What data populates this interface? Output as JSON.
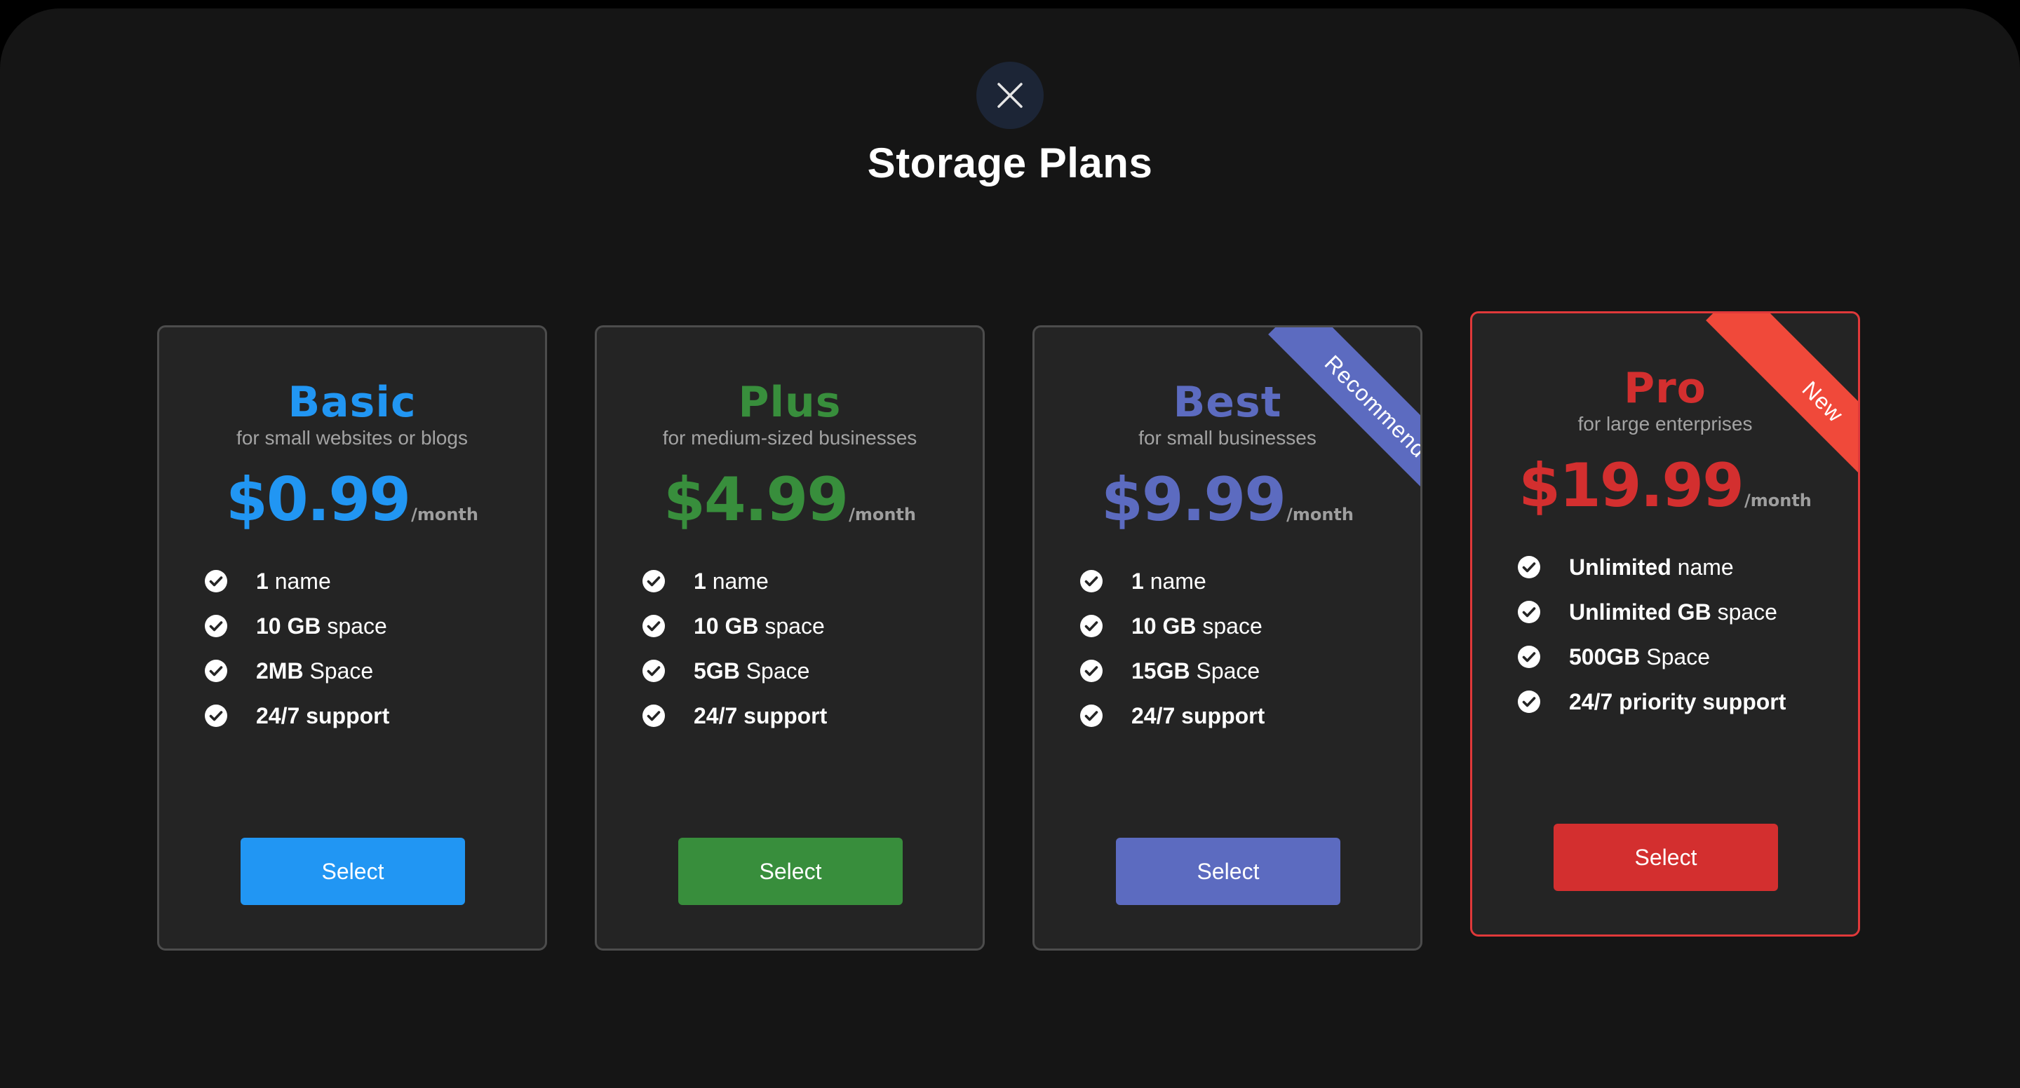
{
  "header": {
    "title": "Storage Plans"
  },
  "plans": [
    {
      "name": "Basic",
      "description": "for small websites or blogs",
      "price": "$0.99",
      "period": "/month",
      "color": "#2196f3",
      "features": [
        {
          "bold": "1",
          "rest": " name"
        },
        {
          "bold": "10 GB",
          "rest": " space"
        },
        {
          "bold": "2MB",
          "rest": " Space"
        },
        {
          "bold": "24/7 support",
          "rest": ""
        }
      ],
      "select_label": "Select"
    },
    {
      "name": "Plus",
      "description": "for medium-sized businesses",
      "price": "$4.99",
      "period": "/month",
      "color": "#388e3c",
      "features": [
        {
          "bold": "1",
          "rest": " name"
        },
        {
          "bold": "10 GB",
          "rest": " space"
        },
        {
          "bold": "5GB",
          "rest": " Space"
        },
        {
          "bold": "24/7 support",
          "rest": ""
        }
      ],
      "select_label": "Select"
    },
    {
      "name": "Best",
      "description": "for small businesses",
      "price": "$9.99",
      "period": "/month",
      "color": "#5c6bc0",
      "ribbon": "Recommended",
      "features": [
        {
          "bold": "1",
          "rest": " name"
        },
        {
          "bold": "10 GB",
          "rest": " space"
        },
        {
          "bold": "15GB",
          "rest": " Space"
        },
        {
          "bold": "24/7 support",
          "rest": ""
        }
      ],
      "select_label": "Select"
    },
    {
      "name": "Pro",
      "description": "for large enterprises",
      "price": "$19.99",
      "period": "/month",
      "color": "#d32f2f",
      "ribbon": "New",
      "features": [
        {
          "bold": "Unlimited",
          "rest": " name"
        },
        {
          "bold": "Unlimited GB",
          "rest": " space"
        },
        {
          "bold": "500GB",
          "rest": " Space"
        },
        {
          "bold": "24/7 priority support",
          "rest": ""
        }
      ],
      "select_label": "Select"
    }
  ],
  "icons": {
    "close": "close-icon",
    "check": "check-circle-icon"
  }
}
